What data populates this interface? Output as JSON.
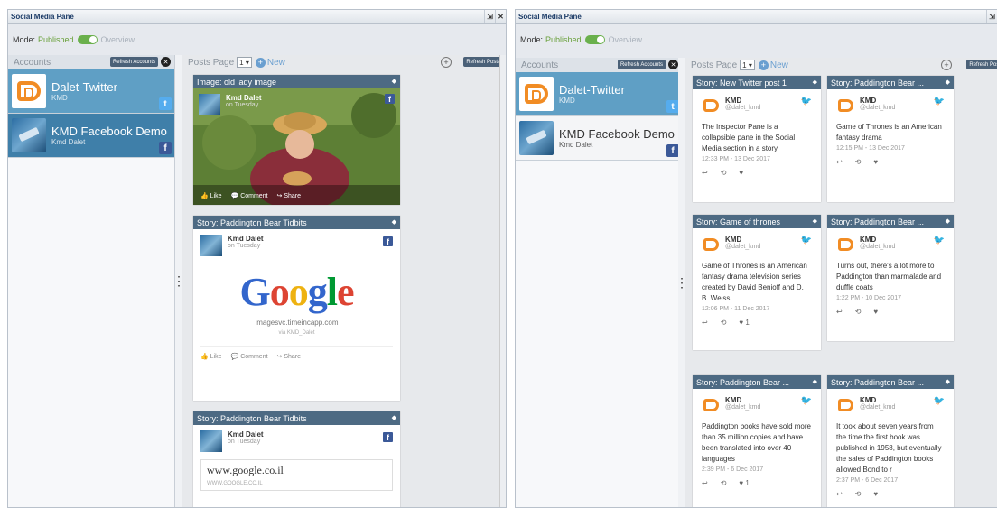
{
  "title": "Social Media Pane",
  "title_btns": {
    "pin": "⇲",
    "close": "✕"
  },
  "mode": {
    "label": "Mode:",
    "published": "Published",
    "overview": "Overview"
  },
  "accounts": {
    "label": "Accounts",
    "refresh": "Refresh Accounts",
    "items": [
      {
        "name": "Dalet-Twitter",
        "sub": "KMD",
        "badge": "t"
      },
      {
        "name": "KMD Facebook Demo",
        "sub": "Kmd Dalet",
        "badge": "f"
      }
    ]
  },
  "posts": {
    "label": "Posts Page",
    "page": "1",
    "new": "New",
    "refresh": "Refresh Posts"
  },
  "left_posts": [
    {
      "header": "Image: old lady image",
      "author": "Kmd Dalet",
      "time": "on Tuesday",
      "actions": [
        "Like",
        "Comment",
        "Share"
      ]
    },
    {
      "header": "Story: Paddington Bear Tidbits",
      "author": "Kmd Dalet",
      "time": "on Tuesday",
      "logo_text": "Google",
      "link_host": "imagesvc.timeincapp.com",
      "via": "via KMD_Dalet",
      "actions": [
        "Like",
        "Comment",
        "Share"
      ]
    },
    {
      "header": "Story: Paddington Bear Tidbits",
      "author": "Kmd Dalet",
      "time": "on Tuesday",
      "link_title": "www.google.co.il",
      "link_url": "WWW.GOOGLE.CO.IL"
    }
  ],
  "tweets": [
    {
      "header": "Story: New Twitter post 1",
      "name": "KMD",
      "handle": "@dalet_kmd",
      "text": "The Inspector Pane is a collapsible pane in the Social Media section in a story",
      "time": "12:33 PM - 13 Dec 2017",
      "likes": ""
    },
    {
      "header": "Story: Paddington Bear ...",
      "name": "KMD",
      "handle": "@dalet_kmd",
      "text": "Game of Thrones is an American fantasy drama",
      "time": "12:15 PM - 13 Dec 2017",
      "likes": ""
    },
    {
      "header": "Story: Game of thrones",
      "name": "KMD",
      "handle": "@dalet_kmd",
      "text": "Game of Thrones is an American fantasy drama television series created by David Benioff and D. B. Weiss.",
      "time": "12:06 PM - 11 Dec 2017",
      "likes": "1"
    },
    {
      "header": "Story: Paddington Bear ...",
      "name": "KMD",
      "handle": "@dalet_kmd",
      "text": "Turns out, there's a lot more to Paddington than marmalade and duffle coats",
      "time": "1:22 PM - 10 Dec 2017",
      "likes": ""
    },
    {
      "header": "Story: Paddington Bear ...",
      "name": "KMD",
      "handle": "@dalet_kmd",
      "text": "Paddington books have sold more than 35 million copies and have been translated into over 40 languages",
      "time": "2:39 PM - 6 Dec 2017",
      "likes": "1"
    },
    {
      "header": "Story: Paddington Bear ...",
      "name": "KMD",
      "handle": "@dalet_kmd",
      "text": "It took about seven years from the time the first book was published in 1958, but eventually the sales of Paddington books allowed Bond to r",
      "time": "2:37 PM - 6 Dec 2017",
      "likes": ""
    }
  ],
  "colors": {
    "accent": "#4d6a83",
    "selected": "#5f9fc5",
    "twitter": "#55acee",
    "facebook": "#3b5998",
    "dalet": "#f18c24"
  }
}
